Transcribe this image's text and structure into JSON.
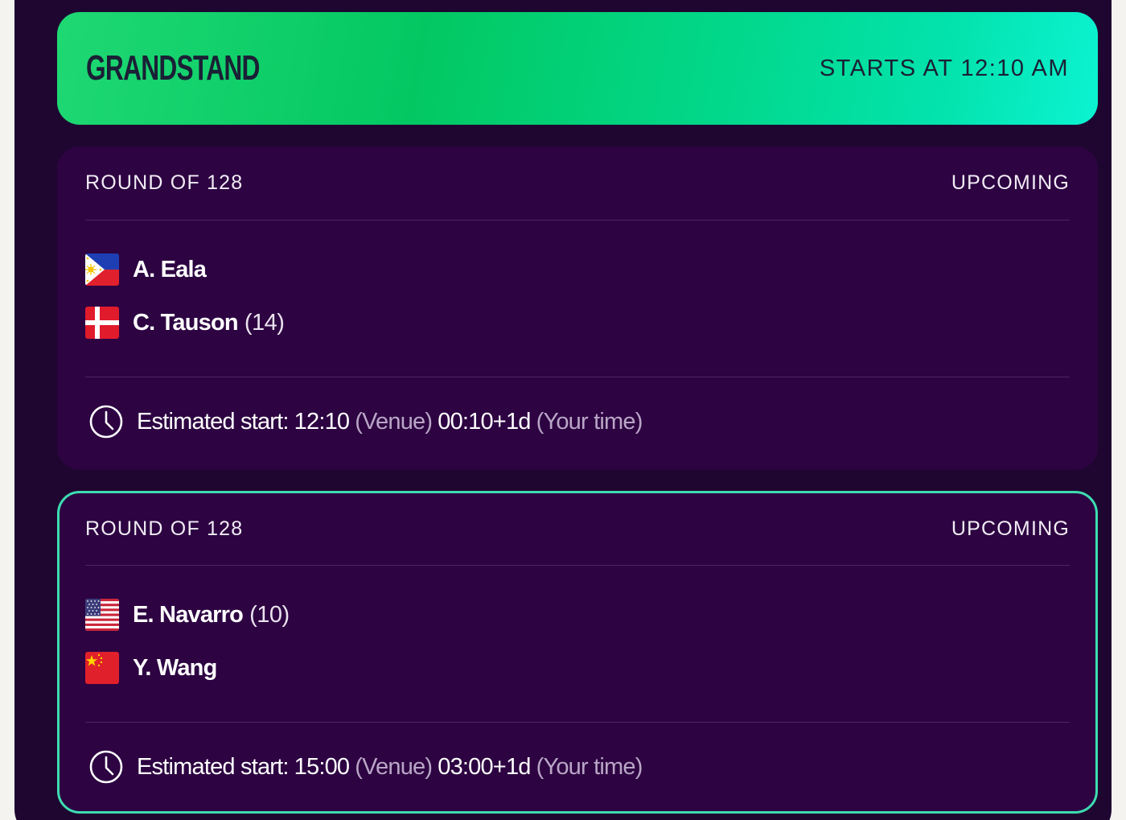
{
  "court": {
    "name": "GRANDSTAND",
    "starts_label": "STARTS AT 12:10 AM"
  },
  "matches": [
    {
      "round": "ROUND OF 128",
      "status": "UPCOMING",
      "players": [
        {
          "name": "A. Eala",
          "seed": "",
          "flag": "philippines-flag-icon"
        },
        {
          "name": "C. Tauson",
          "seed": "(14)",
          "flag": "denmark-flag-icon"
        }
      ],
      "estimated": {
        "label": "Estimated start:",
        "venue_time": "12:10",
        "venue_label": "(Venue)",
        "local_time": "00:10+1d",
        "local_label": "(Your time)"
      }
    },
    {
      "round": "ROUND OF 128",
      "status": "UPCOMING",
      "players": [
        {
          "name": "E. Navarro",
          "seed": "(10)",
          "flag": "usa-flag-icon"
        },
        {
          "name": "Y. Wang",
          "seed": "",
          "flag": "china-flag-icon"
        }
      ],
      "estimated": {
        "label": "Estimated start:",
        "venue_time": "15:00",
        "venue_label": "(Venue)",
        "local_time": "03:00+1d",
        "local_label": "(Your time)"
      }
    }
  ],
  "colors": {
    "header_gradient_start": "#03c862",
    "header_gradient_end": "#0cf3d2",
    "card_background": "#2d0342",
    "page_background": "#1f0631",
    "highlight_border": "#3ddcb0",
    "muted_text": "#b9a6c6"
  }
}
